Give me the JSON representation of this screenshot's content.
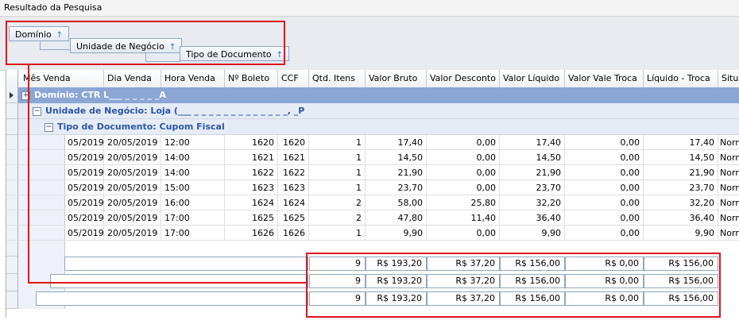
{
  "window": {
    "title": "Resultado da Pesquisa"
  },
  "group_panel": {
    "chips": [
      {
        "label": "Domínio",
        "arrow": "↑"
      },
      {
        "label": "Unidade de Negócio",
        "arrow": "↑"
      },
      {
        "label": "Tipo de Documento",
        "arrow": "↑"
      }
    ]
  },
  "columns": [
    "Mês Venda",
    "Dia Venda",
    "Hora Venda",
    "Nº Boleto",
    "CCF",
    "Qtd. Itens",
    "Valor Bruto",
    "Valor Desconto",
    "Valor Líquido",
    "Valor Vale Troca",
    "Líquido - Troca",
    "Situaç"
  ],
  "groups": {
    "domain": "Domínio: CTR L___ _ _ _ _ _A",
    "unit": "Unidade de Negócio: Loja (___ _ _ _ _ _ _ _ _ _ _ _ _ _, _P",
    "doc_type": "Tipo de Documento: Cupom Fiscal",
    "expand_symbol": "+",
    "collapse_symbol": "−"
  },
  "rows": [
    {
      "mes": "05/2019",
      "dia": "20/05/2019",
      "hora": "12:00",
      "boleto": "1620",
      "ccf": "1620",
      "qtd": "1",
      "bruto": "17,40",
      "desconto": "0,00",
      "liquido": "17,40",
      "vale": "0,00",
      "liq_troca": "17,40",
      "situacao": "Norma"
    },
    {
      "mes": "05/2019",
      "dia": "20/05/2019",
      "hora": "14:00",
      "boleto": "1621",
      "ccf": "1621",
      "qtd": "1",
      "bruto": "14,50",
      "desconto": "0,00",
      "liquido": "14,50",
      "vale": "0,00",
      "liq_troca": "14,50",
      "situacao": "Norma"
    },
    {
      "mes": "05/2019",
      "dia": "20/05/2019",
      "hora": "14:00",
      "boleto": "1622",
      "ccf": "1622",
      "qtd": "1",
      "bruto": "21,90",
      "desconto": "0,00",
      "liquido": "21,90",
      "vale": "0,00",
      "liq_troca": "21,90",
      "situacao": "Norma"
    },
    {
      "mes": "05/2019",
      "dia": "20/05/2019",
      "hora": "15:00",
      "boleto": "1623",
      "ccf": "1623",
      "qtd": "1",
      "bruto": "23,70",
      "desconto": "0,00",
      "liquido": "23,70",
      "vale": "0,00",
      "liq_troca": "23,70",
      "situacao": "Norma"
    },
    {
      "mes": "05/2019",
      "dia": "20/05/2019",
      "hora": "16:00",
      "boleto": "1624",
      "ccf": "1624",
      "qtd": "2",
      "bruto": "58,00",
      "desconto": "25,80",
      "liquido": "32,20",
      "vale": "0,00",
      "liq_troca": "32,20",
      "situacao": "Norma"
    },
    {
      "mes": "05/2019",
      "dia": "20/05/2019",
      "hora": "17:00",
      "boleto": "1625",
      "ccf": "1625",
      "qtd": "2",
      "bruto": "47,80",
      "desconto": "11,40",
      "liquido": "36,40",
      "vale": "0,00",
      "liq_troca": "36,40",
      "situacao": "Norma"
    },
    {
      "mes": "05/2019",
      "dia": "20/05/2019",
      "hora": "17:00",
      "boleto": "1626",
      "ccf": "1626",
      "qtd": "1",
      "bruto": "9,90",
      "desconto": "0,00",
      "liquido": "9,90",
      "vale": "0,00",
      "liq_troca": "9,90",
      "situacao": "Norma"
    }
  ],
  "totals": {
    "qtd": "9",
    "bruto": "R$ 193,20",
    "desconto": "R$ 37,20",
    "liquido": "R$ 156,00",
    "vale": "R$ 0,00",
    "liq_troca": "R$ 156,00"
  },
  "colors": {
    "highlight": "#e0141e",
    "group_header": "#8ba6d4",
    "group_text": "#2d55a4"
  }
}
